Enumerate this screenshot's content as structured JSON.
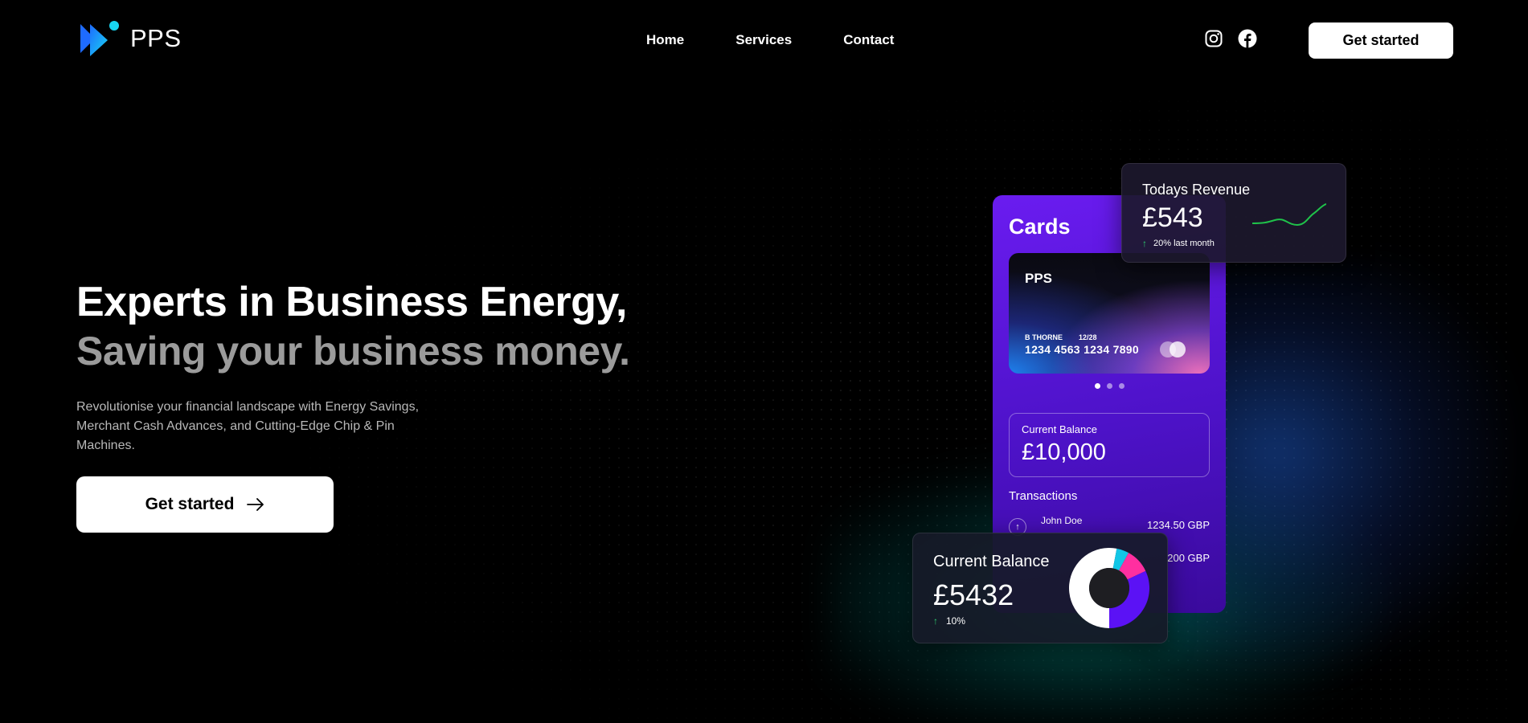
{
  "nav": {
    "brand": "PPS",
    "links": [
      "Home",
      "Services",
      "Contact"
    ],
    "social": [
      "instagram-icon",
      "facebook-icon"
    ],
    "cta": "Get started"
  },
  "hero": {
    "title_line1": "Experts in Business Energy,",
    "title_line2": "Saving your business money.",
    "paragraph": "Revolutionise your financial landscape with Energy Savings, Merchant Cash Advances, and Cutting-Edge Chip & Pin Machines.",
    "cta": "Get started"
  },
  "cards_panel": {
    "title": "Cards",
    "card": {
      "brand": "PPS",
      "holder": "B THORNE",
      "expiry": "12/28",
      "number": "1234 4563 1234 7890"
    },
    "carousel": {
      "count": 3,
      "active": 0
    },
    "balance": {
      "label": "Current Balance",
      "value": "£10,000"
    },
    "transactions_title": "Transactions",
    "transactions": [
      {
        "name": "John Doe",
        "amount": "1234.50 GBP"
      },
      {
        "name": "",
        "amount": "200 GBP"
      }
    ]
  },
  "revenue": {
    "label": "Todays Revenue",
    "value": "£543",
    "delta": "20% last month",
    "spark_color": "#1fc24a"
  },
  "balance_card": {
    "label": "Current Balance",
    "value": "£5432",
    "delta": "10%",
    "donut_segments": [
      {
        "color": "#ffffff",
        "fraction": 0.53
      },
      {
        "color": "#12c6e6",
        "fraction": 0.05
      },
      {
        "color": "#ff2fa0",
        "fraction": 0.1
      },
      {
        "color": "#5b12f5",
        "fraction": 0.32
      }
    ]
  },
  "colors": {
    "accent_purple": "#6a1cf0",
    "background": "#000000",
    "muted_heading": "#9b9b9b"
  }
}
